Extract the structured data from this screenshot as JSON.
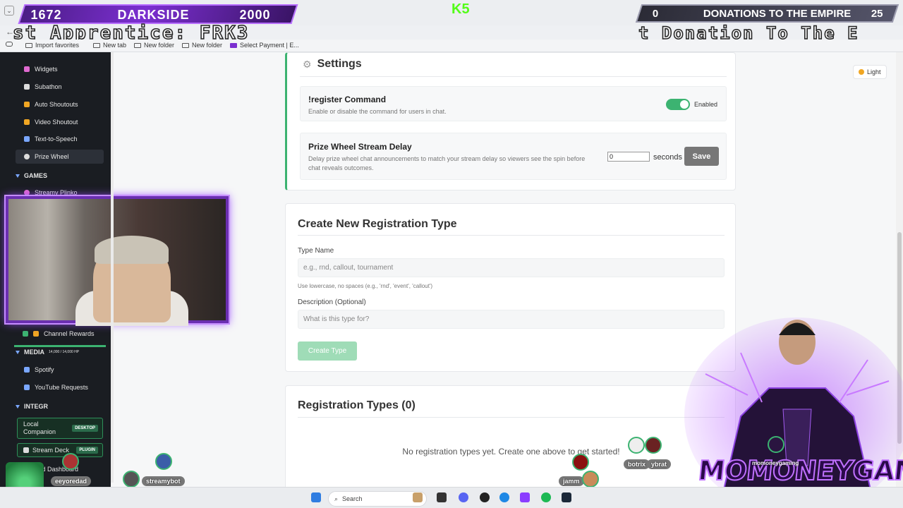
{
  "overlay": {
    "left_count": "1672",
    "left_name": "DARKSIDE",
    "left_goal": "2000",
    "k_badge": "K5",
    "right_count": "0",
    "right_title": "DONATIONS TO THE EMPIRE",
    "right_goal": "25",
    "marquee_left": "st Apprentice: FRK3",
    "marquee_right": "t Donation To The E"
  },
  "bookmarks": [
    "Import favorites",
    "New tab",
    "New folder",
    "New folder",
    "Select Payment | E..."
  ],
  "sidebar": {
    "items_top": [
      {
        "label": "Widgets",
        "icon": "widgets-icon",
        "color": "#e06ad0"
      },
      {
        "label": "Subathon",
        "icon": "hourglass-icon",
        "color": "#dcdcdc"
      },
      {
        "label": "Auto Shoutouts",
        "icon": "megaphone-icon",
        "color": "#f0a623"
      },
      {
        "label": "Video Shoutout",
        "icon": "video-icon",
        "color": "#f0a623"
      },
      {
        "label": "Text-to-Speech",
        "icon": "speaker-icon",
        "color": "#7aa7ff"
      },
      {
        "label": "Prize Wheel",
        "icon": "wheel-icon",
        "color": "#dcdcdc"
      }
    ],
    "games_header": "GAMES",
    "games_item": "Streamy Plinko",
    "channel_rewards": "Channel Rewards",
    "media_header": "MEDIA",
    "hp_text": "14,000 / 14,000 HP",
    "spotify": "Spotify",
    "youtube": "YouTube Requests",
    "integ_header": "INTEGR",
    "local_companion": "Local Companion",
    "desktop_tag": "DESKTOP",
    "stream_deck": "Stream Deck",
    "plugin_tag": "PLUGIN",
    "discord": "Discord Dashboard"
  },
  "settings": {
    "title": "Settings",
    "register_label": "!register Command",
    "register_desc": "Enable or disable the command for users in chat.",
    "toggle_label": "Enabled",
    "delay_label": "Prize Wheel Stream Delay",
    "delay_desc": "Delay prize wheel chat announcements to match your stream delay so viewers see the spin before chat reveals outcomes.",
    "delay_value": "0",
    "seconds_label": "seconds",
    "save_label": "Save"
  },
  "create": {
    "title": "Create New Registration Type",
    "type_name_label": "Type Name",
    "type_name_placeholder": "e.g., rnd, callout, tournament",
    "type_name_hint": "Use lowercase, no spaces (e.g., 'rnd', 'event', 'callout')",
    "desc_label": "Description (Optional)",
    "desc_placeholder": "What is this type for?",
    "button": "Create Type"
  },
  "registrations": {
    "title": "Registration Types (0)",
    "empty": "No registration types yet. Create one above to get started!"
  },
  "theme_toggle": "Light",
  "chat_users": [
    "streamybot",
    "eeyoredad",
    "ninkeratv",
    "botrix",
    "ybrat",
    "jamm",
    "pjrlive",
    "momoneygaming"
  ],
  "brand_logo": "MOMONEYGAMING",
  "taskbar": {
    "search_placeholder": "Search"
  }
}
